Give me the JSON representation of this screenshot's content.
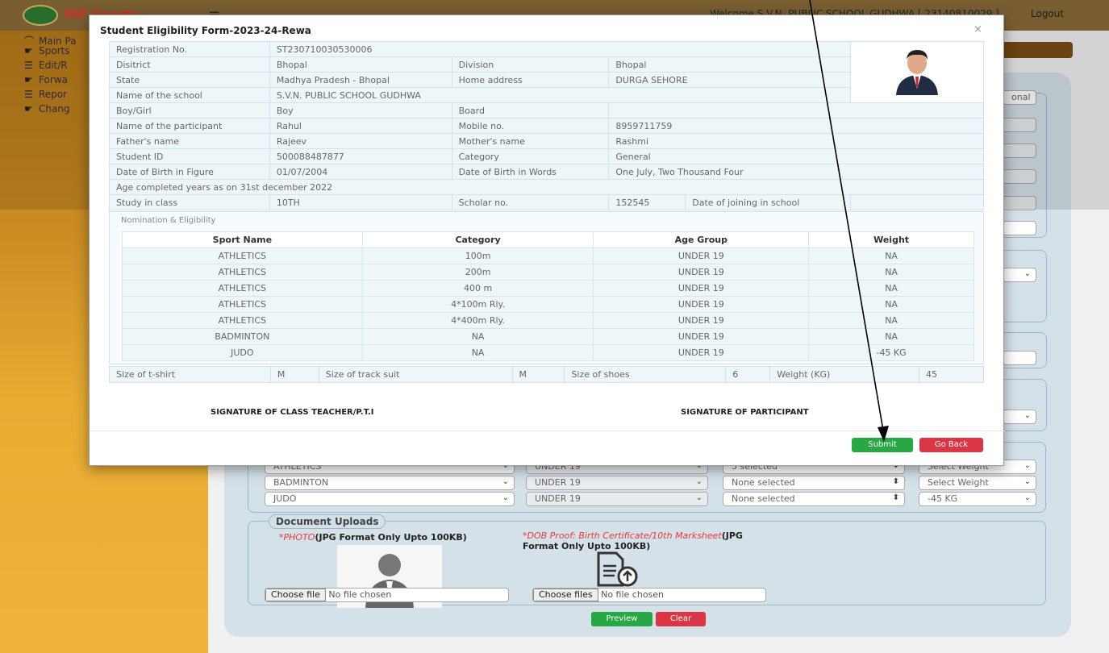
{
  "header": {
    "brand": "MP Sports",
    "welcome": "Welcome S.V.N. PUBLIC SCHOOL GUDHWA [ 23140810029 ]",
    "logout": "Logout"
  },
  "sidebar": {
    "items": [
      {
        "icon": "dashboard-icon",
        "label": "Main Pa"
      },
      {
        "icon": "hand-point-icon",
        "label": "Sports"
      },
      {
        "icon": "list-icon",
        "label": "Edit/R"
      },
      {
        "icon": "hand-point-icon",
        "label": "Forwa"
      },
      {
        "icon": "list-icon",
        "label": "Repor"
      },
      {
        "icon": "hand-point-icon",
        "label": "Chang"
      }
    ]
  },
  "background_form": {
    "optional_label": "onal",
    "sport_rows": [
      {
        "sport": "ATHLETICS",
        "age_group": "UNDER 19",
        "category": "5 selected",
        "weight": "Select Weight"
      },
      {
        "sport": "BADMINTON",
        "age_group": "UNDER 19",
        "category": "None selected",
        "weight": "Select Weight"
      },
      {
        "sport": "JUDO",
        "age_group": "UNDER 19",
        "category": "None selected",
        "weight": "-45 KG"
      }
    ],
    "document_uploads": "Document Uploads",
    "photo_label_red": "*PHOTO",
    "photo_label_rest": "(JPG Format Only Upto 100KB)",
    "dob_label_red": "*DOB Proof: Birth Certificate/10th Marksheet",
    "dob_label_rest": "(JPG Format Only Upto 100KB)",
    "choose_file_btn": "Choose file",
    "no_file_1": "No file chosen",
    "choose_files_btn": "Choose files",
    "no_file_2": "No file chosen",
    "preview_button": "Preview",
    "clear_button": "Clear"
  },
  "modal": {
    "title": "Student Eligibility Form-2023-24-Rewa",
    "close": "×",
    "info": {
      "registration_label": "Registration No.",
      "registration_value": "ST230710030530006",
      "district_label": "Disitrict",
      "district_value": "Bhopal",
      "division_label": "Division",
      "division_value": "Bhopal",
      "state_label": "State",
      "state_value": "Madhya Pradesh - Bhopal",
      "home_address_label": "Home address",
      "home_address_value": "DURGA SEHORE",
      "school_label": "Name of the school",
      "school_value": "S.V.N. PUBLIC SCHOOL GUDHWA",
      "gender_label": "Boy/Girl",
      "gender_value": "Boy",
      "board_label": "Board",
      "board_value": "",
      "participant_label": "Name of the participant",
      "participant_value": "Rahul",
      "mobile_label": "Mobile no.",
      "mobile_value": "8959711759",
      "father_label": "Father's name",
      "father_value": "Rajeev",
      "mother_label": "Mother's name",
      "mother_value": "Rashmi",
      "student_id_label": "Student ID",
      "student_id_value": "500088487877",
      "category_label": "Category",
      "category_value": "General",
      "dob_figure_label": "Date of Birth in Figure",
      "dob_figure_value": "01/07/2004",
      "dob_words_label": "Date of Birth in Words",
      "dob_words_value": "One July, Two Thousand Four",
      "age_completed_label": "Age completed years as on 31st december 2022",
      "class_label": "Study in class",
      "class_value": "10TH",
      "scholar_label": "Scholar no.",
      "scholar_value": "152545",
      "joining_label": "Date of joining in school"
    },
    "nomination": {
      "title": "Nomination & Eligibility",
      "headers": [
        "Sport Name",
        "Category",
        "Age Group",
        "Weight"
      ],
      "rows": [
        [
          "ATHLETICS",
          "100m",
          "UNDER 19",
          "NA"
        ],
        [
          "ATHLETICS",
          "200m",
          "UNDER 19",
          "NA"
        ],
        [
          "ATHLETICS",
          "400 m",
          "UNDER 19",
          "NA"
        ],
        [
          "ATHLETICS",
          "4*100m Rly.",
          "UNDER 19",
          "NA"
        ],
        [
          "ATHLETICS",
          "4*400m Rly.",
          "UNDER 19",
          "NA"
        ],
        [
          "BADMINTON",
          "NA",
          "UNDER 19",
          "NA"
        ],
        [
          "JUDO",
          "NA",
          "UNDER 19",
          "-45 KG"
        ]
      ]
    },
    "sizes": {
      "tshirt_label": "Size of t-shirt",
      "tshirt_value": "M",
      "tracksuit_label": "Size of track suit",
      "tracksuit_value": "M",
      "shoes_label": "Size of shoes",
      "shoes_value": "6",
      "weight_label": "Weight (KG)",
      "weight_value": "45"
    },
    "signature_teacher": "SIGNATURE OF CLASS TEACHER/P.T.I",
    "signature_participant": "SIGNATURE OF PARTICIPANT",
    "submit_button": "Submit",
    "go_back_button": "Go Back"
  },
  "colors": {
    "topbar": "#8a6c3a",
    "sidebar": "#e8ac33",
    "submit": "#28a745",
    "go_back": "#dc3545",
    "required_text": "#e53935"
  }
}
